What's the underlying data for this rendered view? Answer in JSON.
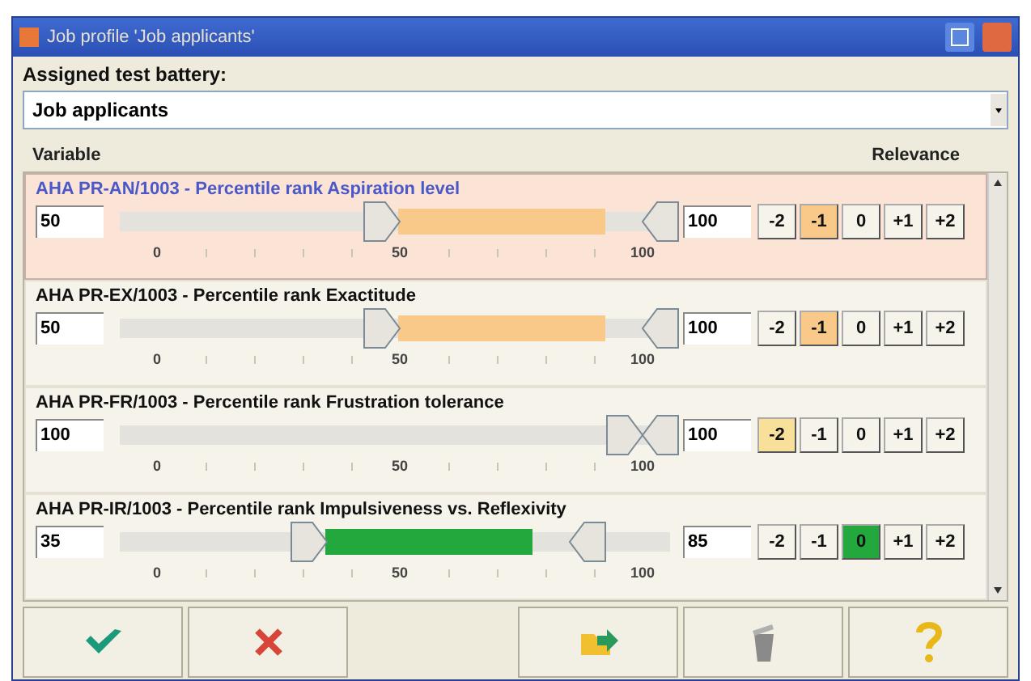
{
  "window": {
    "title": "Job profile 'Job applicants'"
  },
  "battery": {
    "label": "Assigned test battery:",
    "value": "Job applicants"
  },
  "columns": [
    "Variable",
    "Relevance"
  ],
  "variables": [
    {
      "name": "AHA PR-AN/1003 - Percentile rank Aspiration level",
      "selected": true,
      "low": "50",
      "high": "100",
      "color": "#f9c98a",
      "scale": [
        "0",
        "50",
        "100"
      ],
      "relevance": [
        {
          "label": "-2",
          "selected": false
        },
        {
          "label": "-1",
          "selected": true
        },
        {
          "label": "0",
          "selected": false
        },
        {
          "label": "+1",
          "selected": false
        },
        {
          "label": "+2",
          "selected": false
        }
      ]
    },
    {
      "name": "AHA PR-EX/1003 - Percentile rank Exactitude",
      "selected": false,
      "low": "50",
      "high": "100",
      "color": "#f9c98a",
      "scale": [
        "0",
        "50",
        "100"
      ],
      "relevance": [
        {
          "label": "-2",
          "selected": false
        },
        {
          "label": "-1",
          "selected": true
        },
        {
          "label": "0",
          "selected": false
        },
        {
          "label": "+1",
          "selected": false
        },
        {
          "label": "+2",
          "selected": false
        }
      ]
    },
    {
      "name": "AHA PR-FR/1003 - Percentile rank Frustration tolerance",
      "selected": false,
      "low": "100",
      "high": "100",
      "color": "#f8e09a",
      "scale": [
        "0",
        "50",
        "100"
      ],
      "relevance": [
        {
          "label": "-2",
          "selected": true
        },
        {
          "label": "-1",
          "selected": false
        },
        {
          "label": "0",
          "selected": false
        },
        {
          "label": "+1",
          "selected": false
        },
        {
          "label": "+2",
          "selected": false
        }
      ]
    },
    {
      "name": "AHA PR-IR/1003 - Percentile rank Impulsiveness vs. Reflexivity",
      "selected": false,
      "low": "35",
      "high": "85",
      "color": "#22a83c",
      "scale": [
        "0",
        "50",
        "100"
      ],
      "relevance": [
        {
          "label": "-2",
          "selected": false
        },
        {
          "label": "-1",
          "selected": false
        },
        {
          "label": "0",
          "selected": true
        },
        {
          "label": "+1",
          "selected": false
        },
        {
          "label": "+2",
          "selected": false
        }
      ]
    }
  ],
  "buttons": [
    {
      "kind": "ok"
    },
    {
      "kind": "cancel"
    },
    {
      "kind": "spacer"
    },
    {
      "kind": "export"
    },
    {
      "kind": "delete"
    },
    {
      "kind": "help"
    }
  ]
}
